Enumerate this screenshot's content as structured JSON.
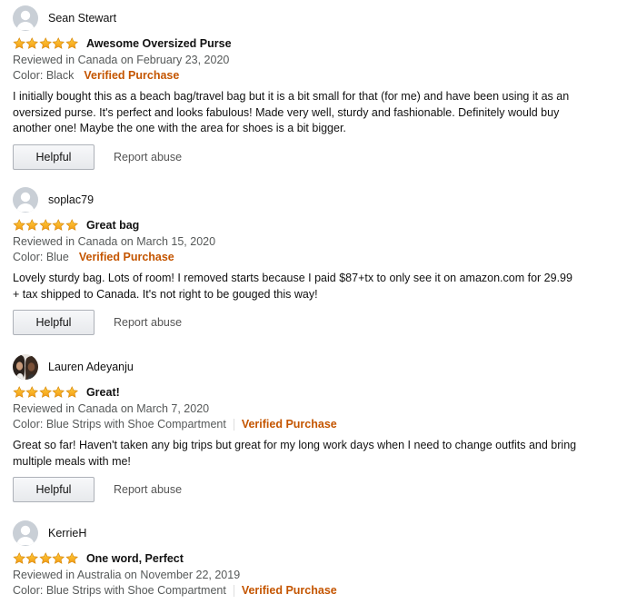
{
  "colors": {
    "star": "#f8a51b",
    "verified": "#c45500",
    "meta_text": "#565959"
  },
  "reviews": [
    {
      "author": "Sean Stewart",
      "avatar": "default-avatar-icon",
      "stars": 5,
      "title": "Awesome Oversized Purse",
      "date": "Reviewed in Canada on February 23, 2020",
      "variant": "Color: Black",
      "verified": "Verified Purchase",
      "body": "I initially bought this as a beach bag/travel bag but it is a bit small for that (for me) and have been using it as an oversized purse. It's perfect and looks fabulous! Made very well, sturdy and fashionable. Definitely would buy another one! Maybe the one with the area for shoes is a bit bigger.",
      "helpful": "Helpful",
      "report": "Report abuse"
    },
    {
      "author": "soplac79",
      "avatar": "default-avatar-icon",
      "stars": 5,
      "title": "Great bag",
      "date": "Reviewed in Canada on March 15, 2020",
      "variant": "Color: Blue",
      "verified": "Verified Purchase",
      "body": "Lovely sturdy bag. Lots of room! I removed starts because I paid $87+tx to only see it on amazon.com for 29.99 + tax shipped to Canada. It's not right to be gouged this way!",
      "helpful": "Helpful",
      "report": "Report abuse"
    },
    {
      "author": "Lauren Adeyanju",
      "avatar": "photo-avatar-icon",
      "stars": 5,
      "title": "Great!",
      "date": "Reviewed in Canada on March 7, 2020",
      "variant": "Color: Blue Strips with Shoe Compartment",
      "verified": "Verified Purchase",
      "body": "Great so far! Haven't taken any big trips but great for my long work days when I need to change outfits and bring multiple meals with me!",
      "helpful": "Helpful",
      "report": "Report abuse"
    },
    {
      "author": "KerrieH",
      "avatar": "default-avatar-icon",
      "stars": 5,
      "title": "One word, Perfect",
      "date": "Reviewed in Australia on November 22, 2019",
      "variant": "Color: Blue Strips with Shoe Compartment",
      "verified": "Verified Purchase"
    }
  ]
}
